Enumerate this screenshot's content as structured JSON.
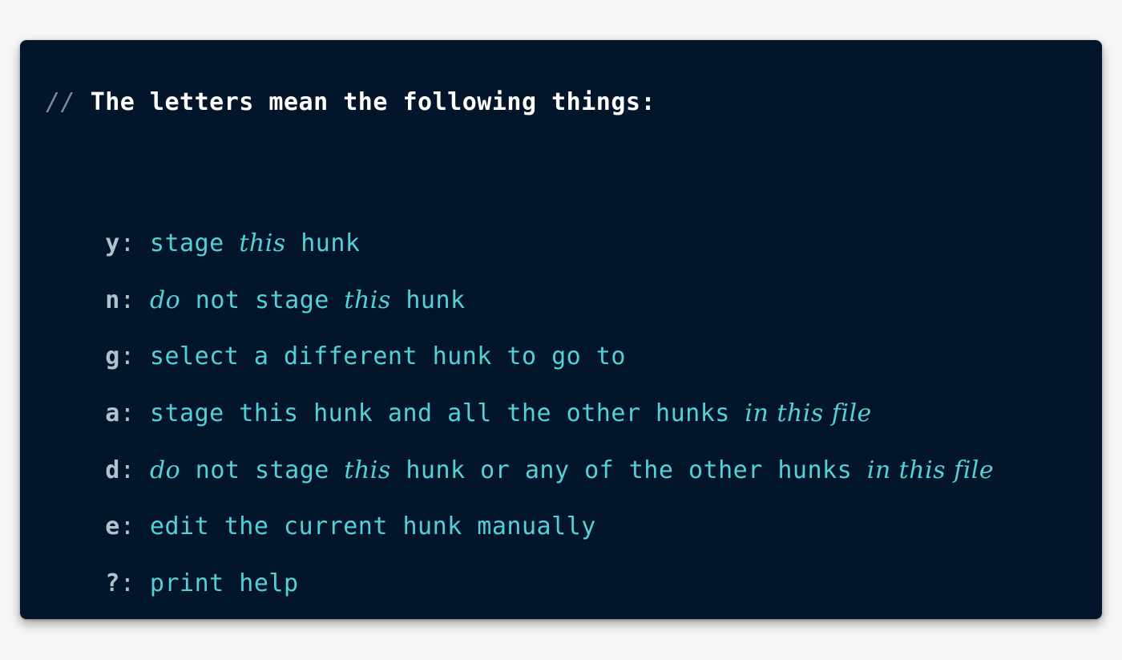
{
  "comment": {
    "slashes": "//",
    "text": "The letters mean the following things:"
  },
  "legend": [
    {
      "key": "y",
      "colon": ":",
      "segments": [
        {
          "text": " stage ",
          "style": "txt"
        },
        {
          "text": "this",
          "style": "em"
        },
        {
          "text": " hunk",
          "style": "txt"
        }
      ]
    },
    {
      "key": "n",
      "colon": ":",
      "segments": [
        {
          "text": " ",
          "style": "txt"
        },
        {
          "text": "do",
          "style": "em"
        },
        {
          "text": " not stage ",
          "style": "txt"
        },
        {
          "text": "this",
          "style": "em"
        },
        {
          "text": " hunk",
          "style": "txt"
        }
      ]
    },
    {
      "key": "g",
      "colon": ":",
      "segments": [
        {
          "text": " select a different hunk to go to",
          "style": "txt"
        }
      ]
    },
    {
      "key": "a",
      "colon": ":",
      "segments": [
        {
          "text": " stage this hunk and all the other hunks ",
          "style": "txt"
        },
        {
          "text": "in this file",
          "style": "em"
        }
      ]
    },
    {
      "key": "d",
      "colon": ":",
      "segments": [
        {
          "text": " ",
          "style": "txt"
        },
        {
          "text": "do",
          "style": "em"
        },
        {
          "text": " not stage ",
          "style": "txt"
        },
        {
          "text": "this",
          "style": "em"
        },
        {
          "text": " hunk or any of the other hunks ",
          "style": "txt"
        },
        {
          "text": "in this file",
          "style": "em"
        }
      ]
    },
    {
      "key": "e",
      "colon": ":",
      "segments": [
        {
          "text": " edit the current hunk manually",
          "style": "txt"
        }
      ]
    },
    {
      "key": "?",
      "colon": ":",
      "segments": [
        {
          "text": " print help",
          "style": "txt"
        }
      ]
    }
  ],
  "colors": {
    "background": "#02152b",
    "page": "#f7f7f7",
    "text": "#52d1d7",
    "key": "#a8c6cc",
    "comment": "#ffffff"
  }
}
